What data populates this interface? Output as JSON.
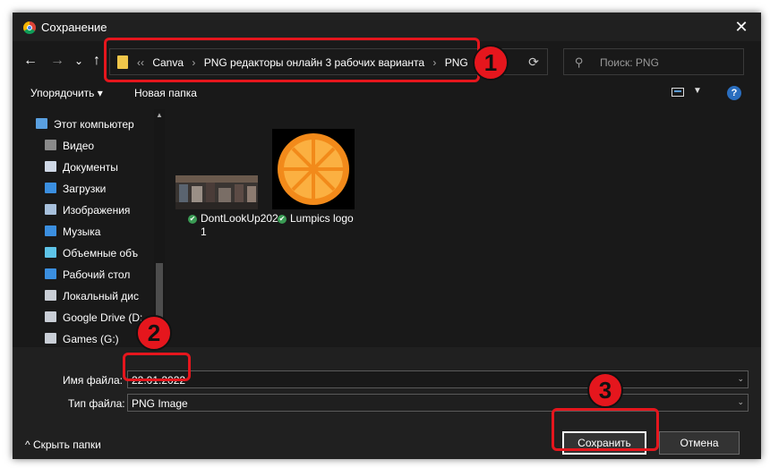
{
  "window": {
    "title": "Сохранение",
    "close_glyph": "✕"
  },
  "nav": {
    "back": "←",
    "forward": "→",
    "recent": "⌄",
    "up": "↑"
  },
  "address": {
    "prefix": "‹‹",
    "crumbs": [
      "Canva",
      "PNG редакторы онлайн 3 рабочих варианта",
      "PNG"
    ],
    "separator": "›",
    "refresh": "⟳"
  },
  "search": {
    "placeholder": "Поиск: PNG",
    "icon": "search-icon"
  },
  "toolbar": {
    "organize": "Упорядочить ▾",
    "new_folder": "Новая папка",
    "help": "?"
  },
  "sidebar": {
    "items": [
      {
        "label": "Этот компьютер",
        "icon": "computer-icon",
        "color": "#5aa0e0"
      },
      {
        "label": "Видео",
        "icon": "video-icon",
        "color": "#8a8a8a"
      },
      {
        "label": "Документы",
        "icon": "documents-icon",
        "color": "#cfd8e6"
      },
      {
        "label": "Загрузки",
        "icon": "download-icon",
        "color": "#3b8fe0"
      },
      {
        "label": "Изображения",
        "icon": "pictures-icon",
        "color": "#a7c0dc"
      },
      {
        "label": "Музыка",
        "icon": "music-icon",
        "color": "#3b8fe0"
      },
      {
        "label": "Объемные объ",
        "icon": "3d-objects-icon",
        "color": "#5ec4e8"
      },
      {
        "label": "Рабочий стол",
        "icon": "desktop-icon",
        "color": "#3b8fe0"
      },
      {
        "label": "Локальный дис",
        "icon": "drive-icon",
        "color": "#c9ced6"
      },
      {
        "label": "Google Drive (D:",
        "icon": "drive-icon",
        "color": "#c9ced6"
      },
      {
        "label": "Games (G:)",
        "icon": "drive-icon",
        "color": "#c9ced6"
      }
    ]
  },
  "files": [
    {
      "name": "DontLookUp2021",
      "status": "✔"
    },
    {
      "name": "Lumpics logo",
      "status": "✔"
    }
  ],
  "form": {
    "filename_label": "Имя файла:",
    "filename_value": "22.01.2022",
    "filetype_label": "Тип файла:",
    "filetype_value": "PNG Image",
    "caret": "⌄"
  },
  "footer": {
    "hide_folders": "^   Скрыть папки",
    "save": "Сохранить",
    "cancel": "Отмена"
  },
  "annotations": {
    "badge1": "1",
    "badge2": "2",
    "badge3": "3",
    "color": "#e5161d"
  }
}
